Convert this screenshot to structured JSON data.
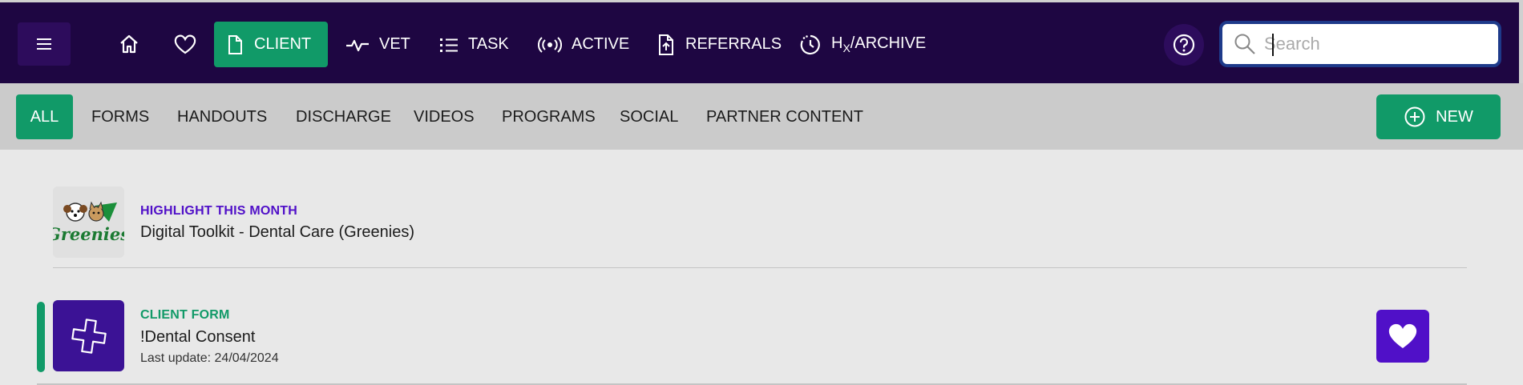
{
  "topnav": {
    "items": [
      {
        "label": "CLIENT",
        "icon": "document-icon",
        "active": true
      },
      {
        "label": "VET",
        "icon": "pulse-icon",
        "active": false
      },
      {
        "label": "TASK",
        "icon": "list-icon",
        "active": false
      },
      {
        "label": "ACTIVE",
        "icon": "broadcast-icon",
        "active": false
      },
      {
        "label": "REFERRALS",
        "icon": "file-upload-icon",
        "active": false
      }
    ],
    "archive": {
      "prefix": "H",
      "sub": "X",
      "suffix": "/ARCHIVE",
      "icon": "clock-history-icon"
    },
    "search_placeholder": "Search",
    "search_value": ""
  },
  "filters": {
    "items": [
      "ALL",
      "FORMS",
      "HANDOUTS",
      "DISCHARGE",
      "VIDEOS",
      "PROGRAMS",
      "SOCIAL",
      "PARTNER CONTENT"
    ],
    "active_index": 0,
    "new_label": "NEW"
  },
  "highlight": {
    "kicker": "HIGHLIGHT THIS MONTH",
    "title": "Digital Toolkit - Dental Care (Greenies)",
    "logo_text": "Greenies"
  },
  "form_item": {
    "kicker": "CLIENT FORM",
    "title": "!Dental Consent",
    "updated": "Last update: 24/04/2024"
  },
  "colors": {
    "nav_bg": "#1e0642",
    "accent_green": "#119a68",
    "kicker_purple": "#5010c8",
    "kicker_green": "#119a68",
    "icon_tile_purple": "#3b1295"
  }
}
